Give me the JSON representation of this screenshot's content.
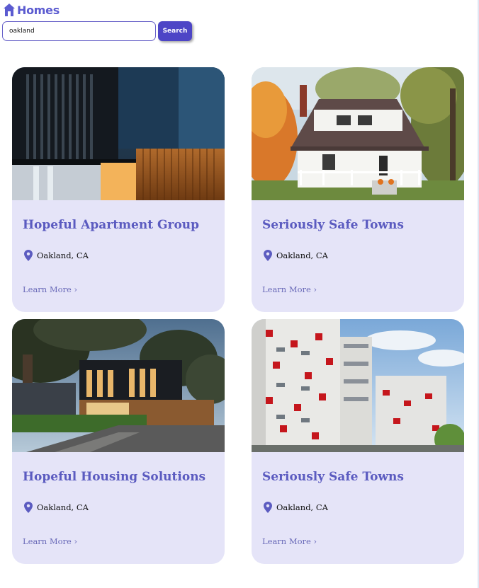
{
  "header": {
    "title": "Homes",
    "icon": "home-icon"
  },
  "search": {
    "value": "oakland",
    "button_label": "Search"
  },
  "colors": {
    "accent": "#4d45c6",
    "card_background": "#e5e4f8",
    "title": "#5b5bc0"
  },
  "cards": [
    {
      "title": "Hopeful Apartment Group",
      "location": "Oakland, CA",
      "link": "Learn More ›",
      "image": "modern-dark-townhouse-photo"
    },
    {
      "title": "Seriously Safe Towns",
      "location": "Oakland, CA",
      "link": "Learn More ›",
      "image": "white-house-with-porch-photo"
    },
    {
      "title": "Hopeful Housing Solutions",
      "location": "Oakland, CA",
      "link": "Learn More ›",
      "image": "modern-house-at-dusk-photo"
    },
    {
      "title": "Seriously Safe Towns",
      "location": "Oakland, CA",
      "link": "Learn More ›",
      "image": "apartment-towers-photo"
    }
  ]
}
